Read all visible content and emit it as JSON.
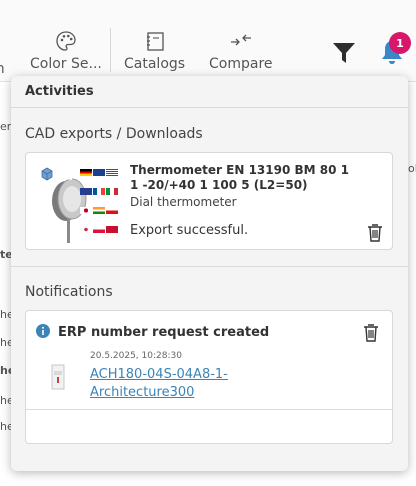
{
  "toolbar": {
    "search_partial": "ch",
    "color_search_label": "Color Se...",
    "catalogs_label": "Catalogs",
    "compare_label": "Compare",
    "notification_count": "1"
  },
  "background": {
    "row_fragments": [
      "er",
      "te",
      "he",
      "he",
      "he",
      "he",
      "he"
    ],
    "right_fragments": [
      "ol"
    ]
  },
  "panel": {
    "title": "Activities",
    "cad_section_title": "CAD exports / Downloads",
    "cad_item": {
      "title": "Thermometer EN 13190 BM 80 1 1 -20/+40 1 100 5 (L2=50)",
      "subtitle": "Dial thermometer",
      "status": "Export successful."
    },
    "notifications_title": "Notifications",
    "notification": {
      "title": "ERP number request created",
      "timestamp": "20.5.2025, 10:28:30",
      "link": "ACH180-04S-04A8-1-Architecture300"
    }
  },
  "colors": {
    "accent_link": "#3a84b8",
    "badge": "#d6176b",
    "bell": "#3a87c8",
    "info_icon": "#3a84b8"
  }
}
